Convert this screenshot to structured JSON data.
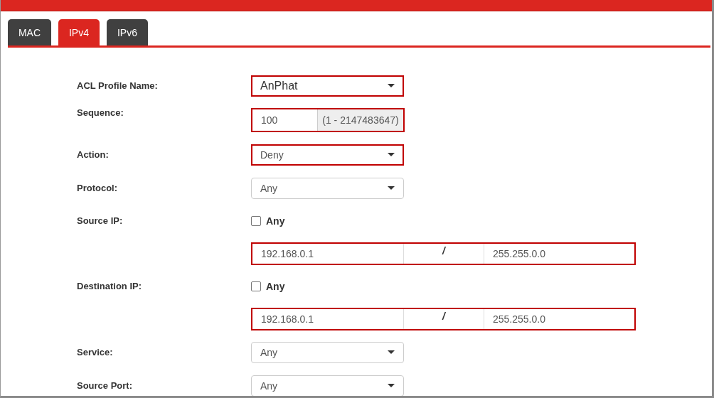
{
  "tabs": [
    {
      "label": "MAC",
      "selected": false
    },
    {
      "label": "IPv4",
      "selected": true
    },
    {
      "label": "IPv6",
      "selected": false
    }
  ],
  "rows": [
    {
      "kind": "select",
      "label": "ACL Profile Name:",
      "value": "AnPhat",
      "highlighted": true,
      "large": true
    },
    {
      "kind": "range",
      "label": "Sequence:",
      "value": "100",
      "addon": "(1 - 2147483647)",
      "highlighted": true
    },
    {
      "kind": "select",
      "label": "Action:",
      "value": "Deny",
      "highlighted": true,
      "large": false
    },
    {
      "kind": "select",
      "label": "Protocol:",
      "value": "Any",
      "highlighted": false,
      "large": false
    },
    {
      "kind": "checkbox",
      "label": "Source IP:",
      "option": "Any",
      "checked": false
    },
    {
      "kind": "ipmask",
      "address": "192.168.0.1",
      "separator": "/",
      "mask": "255.255.0.0",
      "highlighted": true
    },
    {
      "kind": "checkbox",
      "label": "Destination IP:",
      "option": "Any",
      "checked": false
    },
    {
      "kind": "ipmask",
      "address": "192.168.0.1",
      "separator": "/",
      "mask": "255.255.0.0",
      "highlighted": true
    },
    {
      "kind": "select",
      "label": "Service:",
      "value": "Any",
      "highlighted": false,
      "large": false
    },
    {
      "kind": "select",
      "label": "Source Port:",
      "value": "Any",
      "highlighted": false,
      "large": false
    }
  ]
}
